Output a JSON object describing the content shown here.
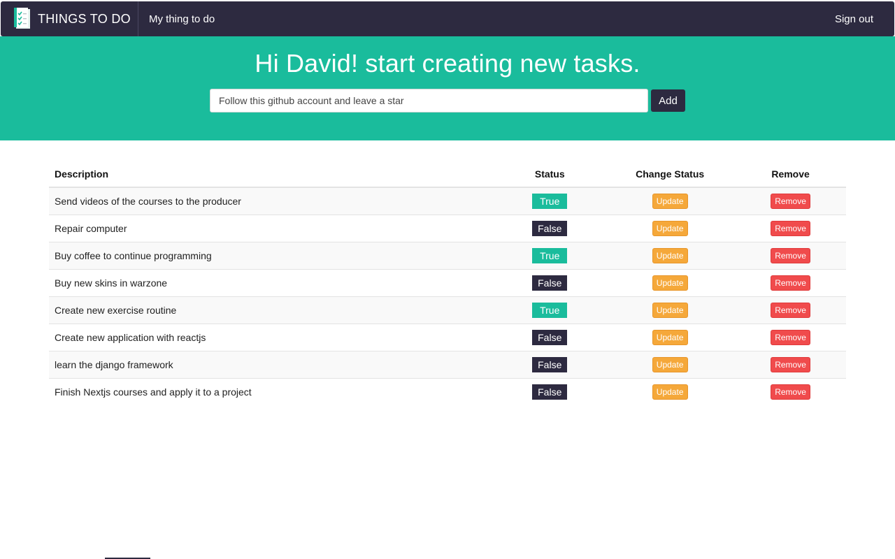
{
  "navbar": {
    "brand": "THINGS TO DO",
    "brand_icon": "checklist-icon",
    "nav_link": "My thing to do",
    "sign_out": "Sign out",
    "color": "#2d2a40"
  },
  "hero": {
    "title": "Hi David! start creating new tasks.",
    "input_value": "Follow this github account and leave a star",
    "add_label": "Add",
    "color": "#1abc9c"
  },
  "table": {
    "headers": {
      "description": "Description",
      "status": "Status",
      "change_status": "Change Status",
      "remove": "Remove"
    },
    "rows": [
      {
        "description": "Send videos of the courses to the producer",
        "status": "True",
        "update": "Update",
        "remove": "Remove"
      },
      {
        "description": "Repair computer",
        "status": "False",
        "update": "Update",
        "remove": "Remove"
      },
      {
        "description": "Buy coffee to continue programming",
        "status": "True",
        "update": "Update",
        "remove": "Remove"
      },
      {
        "description": "Buy new skins in warzone",
        "status": "False",
        "update": "Update",
        "remove": "Remove"
      },
      {
        "description": "Create new exercise routine",
        "status": "True",
        "update": "Update",
        "remove": "Remove"
      },
      {
        "description": "Create new application with reactjs",
        "status": "False",
        "update": "Update",
        "remove": "Remove"
      },
      {
        "description": "learn the django framework",
        "status": "False",
        "update": "Update",
        "remove": "Remove"
      },
      {
        "description": "Finish Nextjs courses and apply it to a project",
        "status": "False",
        "update": "Update",
        "remove": "Remove"
      }
    ]
  },
  "colors": {
    "status_true": "#1abc9c",
    "status_false": "#2d2a40",
    "update": "#f5a83a",
    "remove": "#f04b4c"
  }
}
